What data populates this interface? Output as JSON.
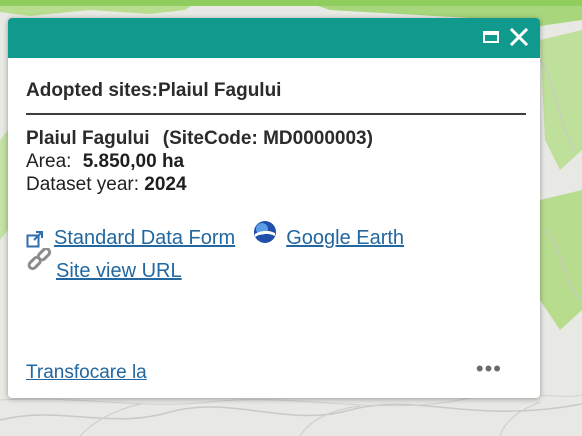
{
  "popup": {
    "title": "Adopted sites:Plaiul Fagului",
    "site_name": "Plaiul Fagului",
    "site_code_text": "(SiteCode: MD0000003)",
    "area_label": "Area:",
    "area_value": "5.850,00 ha",
    "dataset_year_label": "Dataset year:",
    "dataset_year_value": "2024",
    "links": {
      "standard_data_form": "Standard Data Form",
      "google_earth": "Google Earth",
      "site_view_url": "Site view URL"
    },
    "footer": {
      "zoom_to": "Transfocare la",
      "more": "•••"
    },
    "icons": {
      "maximize": "maximize-icon",
      "close": "close-icon",
      "external_link": "external-link-icon",
      "google_earth": "google-earth-icon",
      "link_chain": "link-chain-icon"
    }
  },
  "colors": {
    "header": "#0f9a8d",
    "link": "#22679f",
    "map_background": "#e9eae6",
    "map_green": "#b6dc8c"
  }
}
